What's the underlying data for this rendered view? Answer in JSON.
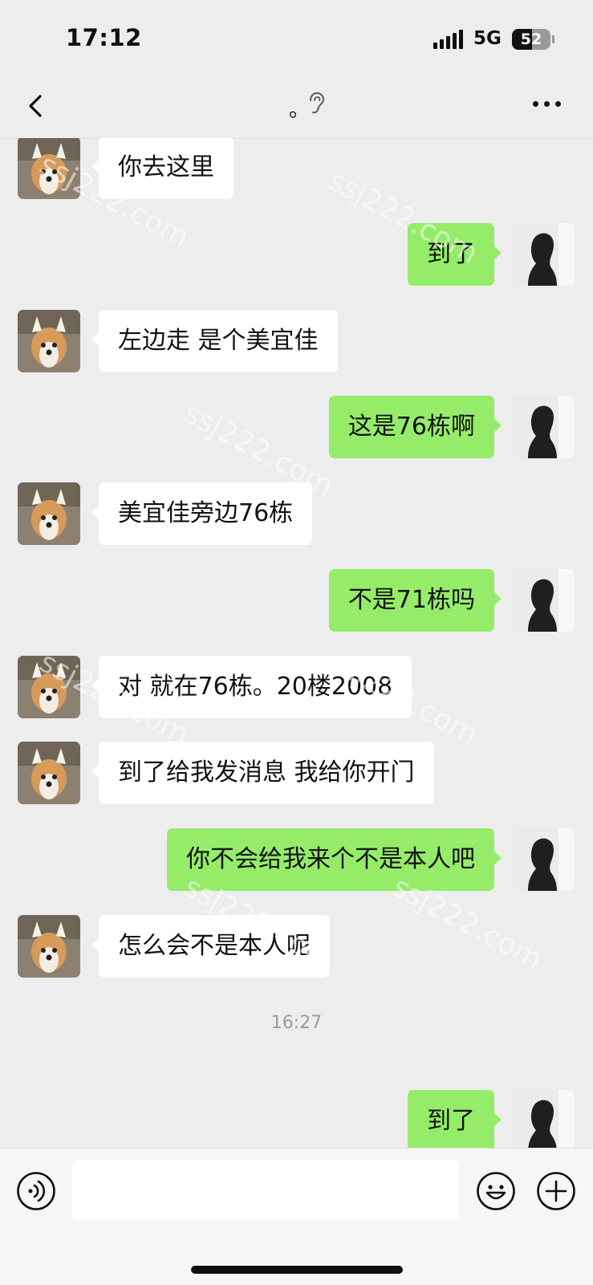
{
  "status": {
    "time": "17:12",
    "network": "5G",
    "battery": "52",
    "battery_level_percent": 52
  },
  "header": {
    "title": "。"
  },
  "watermark": "ssj222.com",
  "messages": [
    {
      "side": "in",
      "text": "你去这里"
    },
    {
      "side": "out",
      "text": "到了"
    },
    {
      "side": "in",
      "text": "左边走 是个美宜佳"
    },
    {
      "side": "out",
      "text": "这是76栋啊"
    },
    {
      "side": "in",
      "text": "美宜佳旁边76栋"
    },
    {
      "side": "out",
      "text": "不是71栋吗"
    },
    {
      "side": "in",
      "text": "对 就在76栋。20楼2008"
    },
    {
      "side": "in",
      "text": "到了给我发消息 我给你开门"
    },
    {
      "side": "out",
      "text": "你不会给我来个不是本人吧"
    },
    {
      "side": "in",
      "text": "怎么会不是本人呢"
    },
    {
      "timestamp": "16:27"
    },
    {
      "side": "out",
      "text": "到了"
    }
  ],
  "input": {
    "placeholder": ""
  },
  "icons": {
    "back": "chevron-left-icon",
    "ear": "ear-icon",
    "more": "more-dots-icon",
    "voice": "voice-icon",
    "emoji": "emoji-icon",
    "plus": "plus-icon"
  },
  "colors": {
    "background": "#ededed",
    "outgoing_bubble": "#95ec69",
    "incoming_bubble": "#ffffff"
  }
}
